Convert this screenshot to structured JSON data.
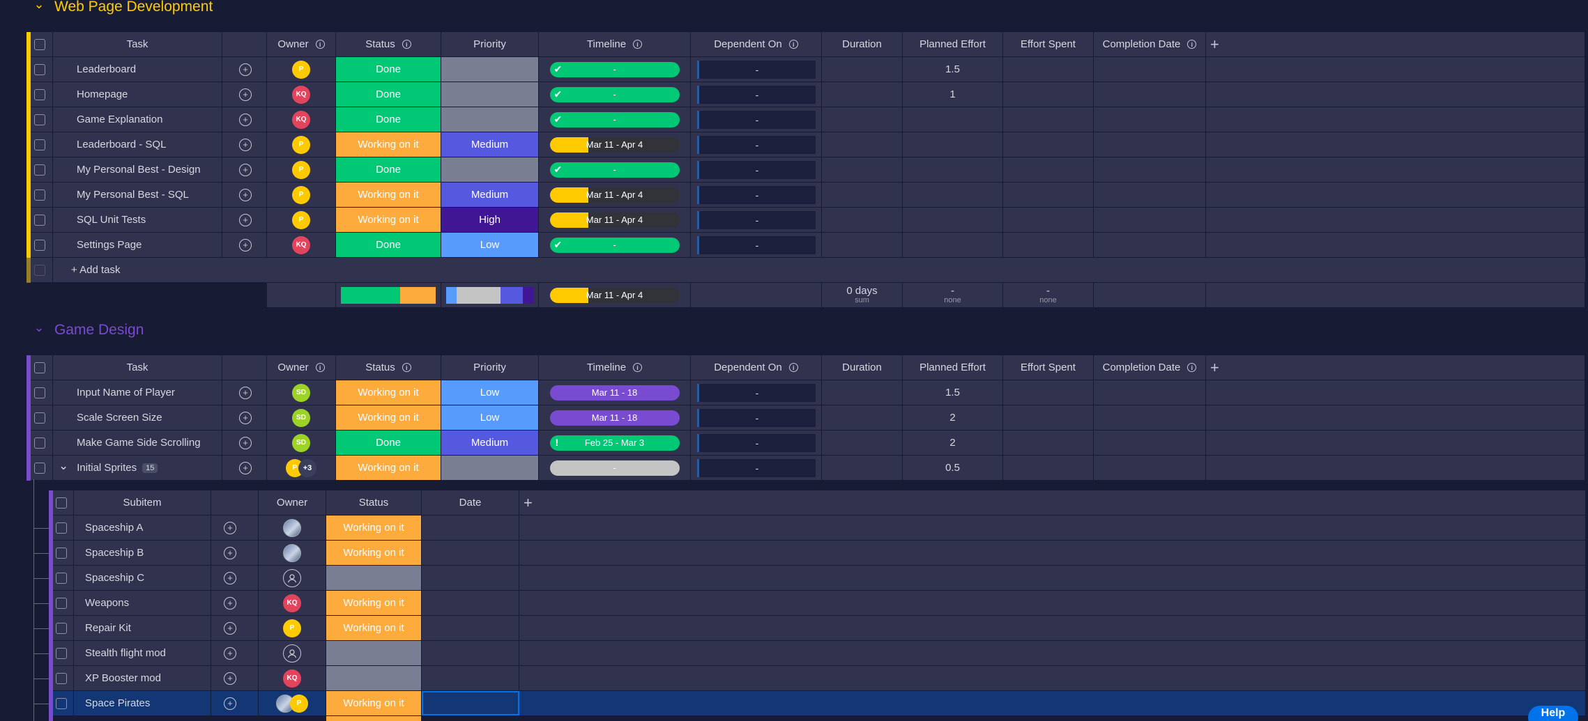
{
  "columns": {
    "task": "Task",
    "owner": "Owner",
    "status": "Status",
    "priority": "Priority",
    "timeline": "Timeline",
    "dependent_on": "Dependent On",
    "duration": "Duration",
    "planned_effort": "Planned Effort",
    "effort_spent": "Effort Spent",
    "completion_date": "Completion Date",
    "add": "+"
  },
  "groups": [
    {
      "title": "Web Page Development",
      "color": "#ffcb00",
      "add_task": "+ Add task",
      "rows": [
        {
          "task": "Leaderboard",
          "owner": "P",
          "owner_kind": "p",
          "status": "Done",
          "status_kind": "done",
          "priority": "",
          "priority_kind": "empty",
          "timeline": "-",
          "timeline_kind": "green-check",
          "dependent": "-",
          "planned": "1.5"
        },
        {
          "task": "Homepage",
          "owner": "KQ",
          "owner_kind": "kq",
          "status": "Done",
          "status_kind": "done",
          "priority": "",
          "priority_kind": "empty",
          "timeline": "-",
          "timeline_kind": "green-check",
          "dependent": "-",
          "planned": "1"
        },
        {
          "task": "Game Explanation",
          "owner": "KQ",
          "owner_kind": "kq",
          "status": "Done",
          "status_kind": "done",
          "priority": "",
          "priority_kind": "empty",
          "timeline": "-",
          "timeline_kind": "green-check",
          "dependent": "-",
          "planned": ""
        },
        {
          "task": "Leaderboard - SQL",
          "owner": "P",
          "owner_kind": "p",
          "status": "Working on it",
          "status_kind": "work",
          "priority": "Medium",
          "priority_kind": "medium",
          "timeline": "Mar 11 - Apr 4",
          "timeline_kind": "split",
          "dependent": "-",
          "planned": ""
        },
        {
          "task": "My Personal Best - Design",
          "owner": "P",
          "owner_kind": "p",
          "status": "Done",
          "status_kind": "done",
          "priority": "",
          "priority_kind": "empty",
          "timeline": "-",
          "timeline_kind": "green-check",
          "dependent": "-",
          "planned": ""
        },
        {
          "task": "My Personal Best - SQL",
          "owner": "P",
          "owner_kind": "p",
          "status": "Working on it",
          "status_kind": "work",
          "priority": "Medium",
          "priority_kind": "medium",
          "timeline": "Mar 11 - Apr 4",
          "timeline_kind": "split",
          "dependent": "-",
          "planned": ""
        },
        {
          "task": "SQL Unit Tests",
          "owner": "P",
          "owner_kind": "p",
          "status": "Working on it",
          "status_kind": "work",
          "priority": "High",
          "priority_kind": "high",
          "timeline": "Mar 11 - Apr 4",
          "timeline_kind": "split",
          "dependent": "-",
          "planned": ""
        },
        {
          "task": "Settings Page",
          "owner": "KQ",
          "owner_kind": "kq",
          "status": "Done",
          "status_kind": "done",
          "priority": "Low",
          "priority_kind": "low",
          "timeline": "-",
          "timeline_kind": "green-check",
          "dependent": "-",
          "planned": ""
        }
      ],
      "summary": {
        "timeline": "Mar 11 - Apr 4",
        "duration": "0 days",
        "duration_sub": "sum",
        "planned": "-",
        "planned_sub": "none",
        "spent": "-",
        "spent_sub": "none",
        "status_dist": [
          {
            "color": "#00c875",
            "share": 0.625
          },
          {
            "color": "#fdab3d",
            "share": 0.375
          }
        ],
        "priority_dist": [
          {
            "color": "#579bfc",
            "share": 0.125
          },
          {
            "color": "#c4c4c4",
            "share": 0.5
          },
          {
            "color": "#5559df",
            "share": 0.25
          },
          {
            "color": "#401694",
            "share": 0.125
          }
        ]
      }
    },
    {
      "title": "Game Design",
      "color": "#784bd1",
      "rows": [
        {
          "task": "Input Name of Player",
          "owner": "SD",
          "owner_kind": "sd",
          "status": "Working on it",
          "status_kind": "work",
          "priority": "Low",
          "priority_kind": "low",
          "timeline": "Mar 11 - 18",
          "timeline_kind": "purple",
          "dependent": "-",
          "planned": "1.5"
        },
        {
          "task": "Scale Screen Size",
          "owner": "SD",
          "owner_kind": "sd",
          "status": "Working on it",
          "status_kind": "work",
          "priority": "Low",
          "priority_kind": "low",
          "timeline": "Mar 11 - 18",
          "timeline_kind": "purple",
          "dependent": "-",
          "planned": "2"
        },
        {
          "task": "Make Game Side Scrolling",
          "owner": "SD",
          "owner_kind": "sd",
          "status": "Done",
          "status_kind": "done",
          "priority": "Medium",
          "priority_kind": "medium",
          "timeline": "Feb 25 - Mar 3",
          "timeline_kind": "green-bang",
          "dependent": "-",
          "planned": "2"
        },
        {
          "task": "Initial Sprites",
          "owner": "P",
          "owner_kind": "p",
          "owner_extra": "+3",
          "status": "Working on it",
          "status_kind": "work",
          "priority": "",
          "priority_kind": "empty",
          "timeline": "-",
          "timeline_kind": "gray",
          "dependent": "-",
          "planned": "0.5",
          "sub_count": "15",
          "expanded": true
        }
      ]
    }
  ],
  "subitems": {
    "columns": {
      "subitem": "Subitem",
      "owner": "Owner",
      "status": "Status",
      "date": "Date",
      "add": "+"
    },
    "rows": [
      {
        "name": "Spaceship A",
        "owner_kind": "photo",
        "owner": "",
        "status": "Working on it",
        "status_kind": "work"
      },
      {
        "name": "Spaceship B",
        "owner_kind": "photo",
        "owner": "",
        "status": "Working on it",
        "status_kind": "work"
      },
      {
        "name": "Spaceship C",
        "owner_kind": "empty",
        "owner": "",
        "status": "",
        "status_kind": "empty"
      },
      {
        "name": "Weapons",
        "owner_kind": "kq",
        "owner": "KQ",
        "status": "Working on it",
        "status_kind": "work"
      },
      {
        "name": "Repair Kit",
        "owner_kind": "p",
        "owner": "P",
        "status": "Working on it",
        "status_kind": "work"
      },
      {
        "name": "Stealth flight mod",
        "owner_kind": "empty",
        "owner": "",
        "status": "",
        "status_kind": "empty"
      },
      {
        "name": "XP Booster mod",
        "owner_kind": "kq",
        "owner": "KQ",
        "status": "",
        "status_kind": "empty"
      },
      {
        "name": "Space Pirates",
        "owner_kind": "photo+p",
        "owner": "P",
        "status": "Working on it",
        "status_kind": "work",
        "selected": true
      }
    ]
  },
  "help_label": "Help"
}
